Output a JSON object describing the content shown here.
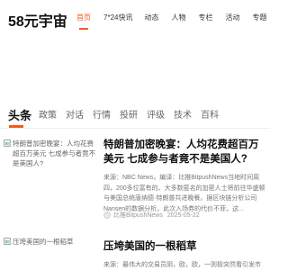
{
  "header": {
    "logo": "58元宇宙",
    "nav": [
      "首页",
      "7*24快讯",
      "动态",
      "人物",
      "专栏",
      "活动",
      "专题"
    ],
    "active_nav": "首页",
    "accent": "#f25d1c"
  },
  "tabs": {
    "items": [
      "头条",
      "政策",
      "对话",
      "行情",
      "投研",
      "评级",
      "技术",
      "百科"
    ],
    "active": "头条"
  },
  "articles": [
    {
      "image_alt": "特朗普加密晚宴：人均花费超百万美元 七成参与者竟不是美国人?",
      "title": "特朗普加密晚宴：人均花费超百万美元 七成参与者竟不是美国人?",
      "summary": "来源：NBC News，编译：比推BitpushNews当地时间周四，200多位富有的、大多数匿名的加密人士将前往华盛顿与美国总统唐纳德·特朗普共进晚餐。据区块链分析公司Nansen的数据分析，此次入场券的代价不菲，这...",
      "author": "比推BitpushNews",
      "date": "2025-05-22"
    },
    {
      "image_alt": "压垮美国的一根稻草",
      "title": "压垮美国的一根稻草",
      "summary": "来源：最伟大的交易员阴，欧，欧，一则极突然看引发市场连锁反应，美"
    }
  ]
}
